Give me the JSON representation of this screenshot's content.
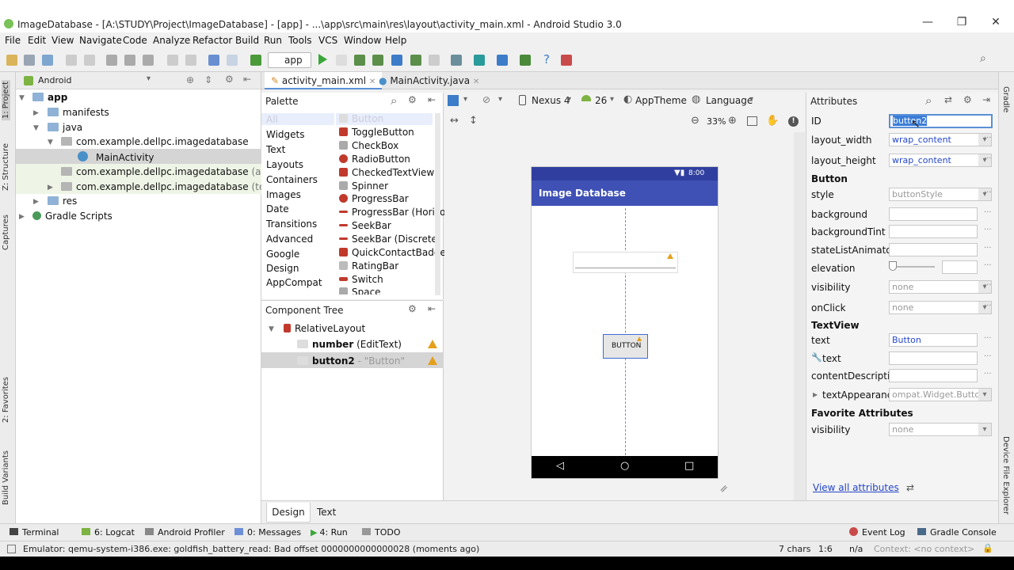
{
  "window": {
    "title": "ImageDatabase - [A:\\STUDY\\Project\\ImageDatabase] - [app] - ...\\app\\src\\main\\res\\layout\\activity_main.xml - Android Studio 3.0",
    "minimize": "—",
    "maximize": "❐",
    "close": "✕"
  },
  "menu": [
    "File",
    "Edit",
    "View",
    "Navigate",
    "Code",
    "Analyze",
    "Refactor",
    "Build",
    "Run",
    "Tools",
    "VCS",
    "Window",
    "Help"
  ],
  "toolbar": {
    "run_config": "app"
  },
  "left_strip": [
    "1: Project",
    "Z: Structure",
    "Captures",
    "2: Favorites",
    "Build Variants"
  ],
  "right_strip": [
    "Gradle",
    "Device File Explorer"
  ],
  "project": {
    "view": "Android",
    "tree": [
      {
        "label": "app",
        "bold": true
      },
      {
        "label": "manifests"
      },
      {
        "label": "java"
      },
      {
        "label": "com.example.dellpc.imagedatabase"
      },
      {
        "label": "MainActivity"
      },
      {
        "label": "com.example.dellpc.imagedatabase",
        "suffix": "(androidTe"
      },
      {
        "label": "com.example.dellpc.imagedatabase",
        "suffix": "(test)"
      },
      {
        "label": "res"
      },
      {
        "label": "Gradle Scripts"
      }
    ]
  },
  "editor_tabs": [
    "activity_main.xml",
    "MainActivity.java"
  ],
  "design_toolbar": {
    "device": "Nexus 4",
    "api": "26",
    "theme": "AppTheme",
    "language": "Language",
    "zoom": "33%"
  },
  "palette": {
    "title": "Palette",
    "categories": [
      "All",
      "Widgets",
      "Text",
      "Layouts",
      "Containers",
      "Images",
      "Date",
      "Transitions",
      "Advanced",
      "Google",
      "Design",
      "AppCompat"
    ],
    "items": [
      "Button",
      "ToggleButton",
      "CheckBox",
      "RadioButton",
      "CheckedTextView",
      "Spinner",
      "ProgressBar",
      "ProgressBar (Horizon",
      "SeekBar",
      "SeekBar (Discrete)",
      "QuickContactBadge",
      "RatingBar",
      "Switch",
      "Space"
    ]
  },
  "component_tree": {
    "title": "Component Tree",
    "root": "RelativeLayout",
    "rows": [
      {
        "name": "number",
        "type": "(EditText)"
      },
      {
        "name": "button2",
        "type": "- \"Button\""
      }
    ]
  },
  "phone": {
    "time": "8:00",
    "app_title": "Image Database",
    "button_label": "BUTTON"
  },
  "attributes": {
    "title": "Attributes",
    "id_label": "ID",
    "id_value": "button2",
    "layout_width_label": "layout_width",
    "layout_width": "wrap_content",
    "layout_height_label": "layout_height",
    "layout_height": "wrap_content",
    "section_button": "Button",
    "style_label": "style",
    "style": "buttonStyle",
    "background_label": "background",
    "backgroundTint_label": "backgroundTint",
    "stateListAnimator_label": "stateListAnimator",
    "elevation_label": "elevation",
    "visibility_label": "visibility",
    "visibility": "none",
    "onClick_label": "onClick",
    "onClick": "none",
    "section_textview": "TextView",
    "text_label": "text",
    "text": "Button",
    "text2_label": "text",
    "contentDescription_label": "contentDescription",
    "textAppearance_label": "textAppearance",
    "textAppearance": "ompat.Widget.Button",
    "section_fav": "Favorite Attributes",
    "fav_visibility_label": "visibility",
    "fav_visibility": "none",
    "view_all": "View all attributes"
  },
  "bottom_tabs": [
    "Design",
    "Text"
  ],
  "tool_windows": [
    "Terminal",
    "6: Logcat",
    "Android Profiler",
    "0: Messages",
    "4: Run",
    "TODO",
    "Event Log",
    "Gradle Console"
  ],
  "status": {
    "message": "Emulator: qemu-system-i386.exe: goldfish_battery_read: Bad offset 0000000000000028 (moments ago)",
    "chars": "7 chars",
    "pos": "1:6",
    "na": "n/a",
    "context": "Context: <no context>"
  },
  "colors": {
    "toolbar_blue": "#3f51b5",
    "nav_black": "#000000",
    "accent": "#2446c7",
    "warning": "#e5a01b"
  }
}
